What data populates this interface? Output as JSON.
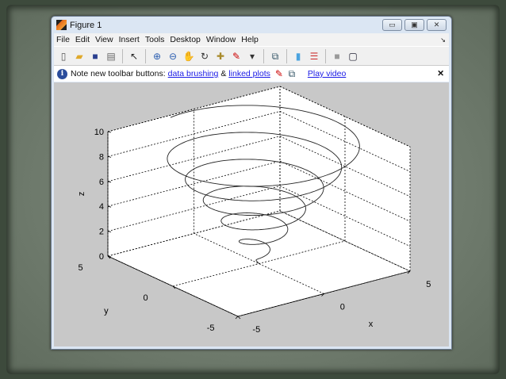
{
  "window": {
    "title": "Figure 1",
    "min": "▭",
    "max": "▣",
    "close": "✕"
  },
  "menu": [
    "File",
    "Edit",
    "View",
    "Insert",
    "Tools",
    "Desktop",
    "Window",
    "Help"
  ],
  "menu_dock": "↘",
  "toolbar_icons": [
    "new-file-icon",
    "open-folder-icon",
    "save-icon",
    "print-icon",
    "|",
    "pointer-icon",
    "|",
    "zoom-in-icon",
    "zoom-out-icon",
    "pan-hand-icon",
    "rotate-3d-icon",
    "data-cursor-icon",
    "brush-icon",
    "dropdown-arrow-icon",
    "|",
    "link-plot-icon",
    "|",
    "colorbar-icon",
    "legend-icon",
    "|",
    "hide-plot-tools-icon",
    "show-plot-tools-icon"
  ],
  "infobar": {
    "note": "Note new toolbar buttons:",
    "link1": "data brushing",
    "amp": "&",
    "link2": "linked plots",
    "link3": "Play video",
    "close": "✕"
  },
  "chart_data": {
    "type": "line3d",
    "title": "",
    "description_formula": "conical helix: x=(z/2)cos t, y=(z/2)sin t",
    "params": {
      "turns": 6,
      "z_range": [
        0,
        10
      ],
      "radius_per_z": 0.5
    },
    "xlabel": "x",
    "ylabel": "y",
    "zlabel": "z",
    "xlim": [
      -5,
      5
    ],
    "ylim": [
      -5,
      5
    ],
    "zlim": [
      0,
      10
    ],
    "xticks": [
      "-5",
      "0",
      "5"
    ],
    "yticks": [
      "-5",
      "0",
      "5"
    ],
    "zticks": [
      "0",
      "2",
      "4",
      "6",
      "8",
      "10"
    ],
    "grid": true,
    "view": {
      "azimuth": -37.5,
      "elevation": 30
    }
  }
}
